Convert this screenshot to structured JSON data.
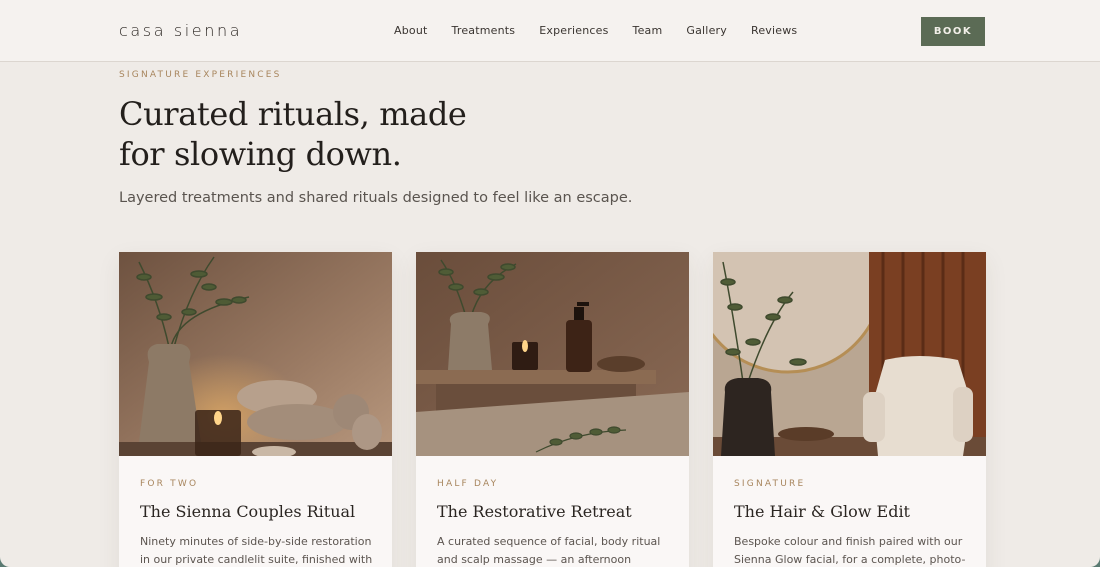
{
  "header": {
    "logo": "casa sienna",
    "nav": [
      "About",
      "Treatments",
      "Experiences",
      "Team",
      "Gallery",
      "Reviews"
    ],
    "book_label": "BOOK"
  },
  "hero": {
    "eyebrow": "SIGNATURE EXPERIENCES",
    "headline_line1": "Curated rituals, made",
    "headline_line2": "for slowing down.",
    "subhead": "Layered treatments and shared rituals designed to feel like an escape."
  },
  "cards": [
    {
      "tag": "FOR TWO",
      "title": "The Sienna Couples Ritual",
      "desc": "Ninety minutes of side-by-side restoration in our private candlelit suite, finished with chilled"
    },
    {
      "tag": "HALF DAY",
      "title": "The Restorative Retreat",
      "desc": "A curated sequence of facial, body ritual and scalp massage — an afternoon designed to"
    },
    {
      "tag": "SIGNATURE",
      "title": "The Hair & Glow Edit",
      "desc": "Bespoke colour and finish paired with our Sienna Glow facial, for a complete, photo-"
    }
  ],
  "colors": {
    "accent": "#5b6b55",
    "eyebrow": "#a8865e",
    "background": "#efebe7"
  }
}
